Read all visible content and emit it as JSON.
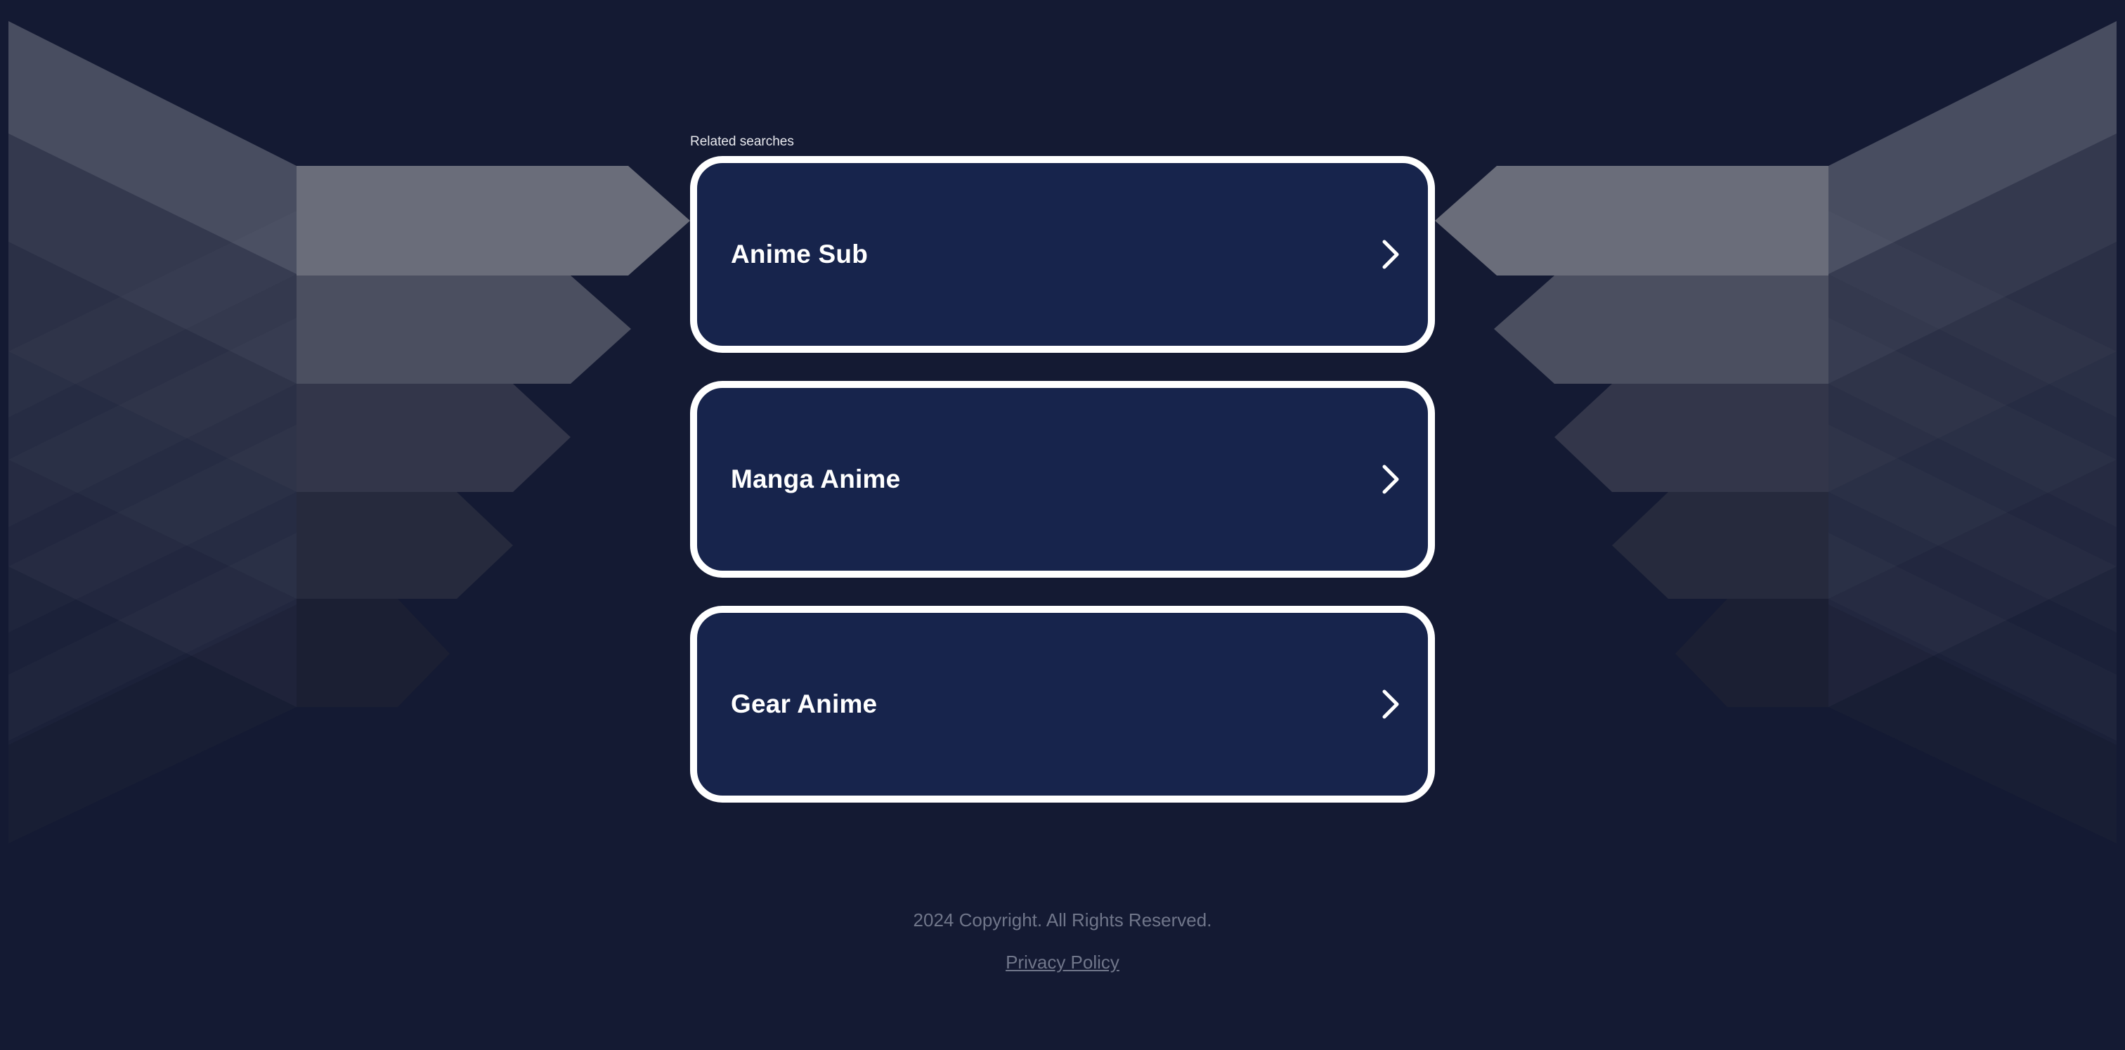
{
  "related_searches_label": "Related searches",
  "cards": [
    {
      "label": "Anime Sub",
      "icon": "chevron-right-icon"
    },
    {
      "label": "Manga Anime",
      "icon": "chevron-right-icon"
    },
    {
      "label": "Gear Anime",
      "icon": "chevron-right-icon"
    }
  ],
  "footer": {
    "copyright": "2024 Copyright. All Rights Reserved.",
    "privacy_link": "Privacy Policy"
  },
  "colors": {
    "background": "#141a33",
    "card_background": "#17244c",
    "card_border": "#ffffff",
    "footer_text": "#70768a"
  }
}
